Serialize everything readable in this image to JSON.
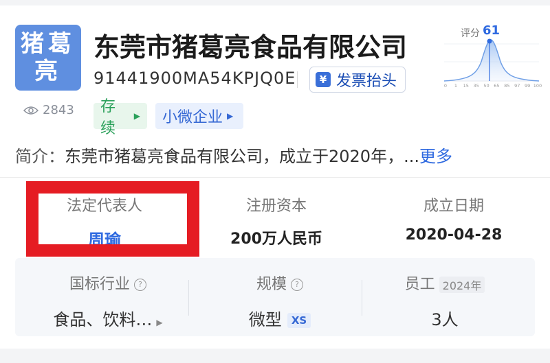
{
  "logo": {
    "text": "猪葛亮"
  },
  "company": {
    "name": "东莞市猪葛亮食品有限公司",
    "credit_code": "91441900MA54KPJQ0E",
    "invoice_button": "发票抬头",
    "views": "2843",
    "status_tag": "存续",
    "size_tag": "小微企业",
    "intro_label": "简介：",
    "intro_text": "东莞市猪葛亮食品有限公司，成立于2020年，...",
    "intro_more": "更多"
  },
  "score": {
    "label": "评分",
    "value": "61",
    "ticks": [
      "0",
      "1",
      "15",
      "35",
      "50",
      "65",
      "85",
      "97",
      "99",
      "100"
    ]
  },
  "info": {
    "legal_rep_label": "法定代表人",
    "legal_rep_value": "周瑜",
    "capital_label": "注册资本",
    "capital_value": "200万人民币",
    "date_label": "成立日期",
    "date_value": "2020-04-28"
  },
  "stats": {
    "industry_label": "国标行业",
    "industry_value": "食品、饮料…",
    "scale_label": "规模",
    "scale_value": "微型",
    "scale_badge": "XS",
    "staff_label": "员工",
    "staff_year": "2024年",
    "staff_value": "3人"
  },
  "colors": {
    "accent": "#2f6ae0",
    "logo_bg": "#5f8fe0",
    "highlight": "#e51c23",
    "status_green": "#2aa05a"
  }
}
